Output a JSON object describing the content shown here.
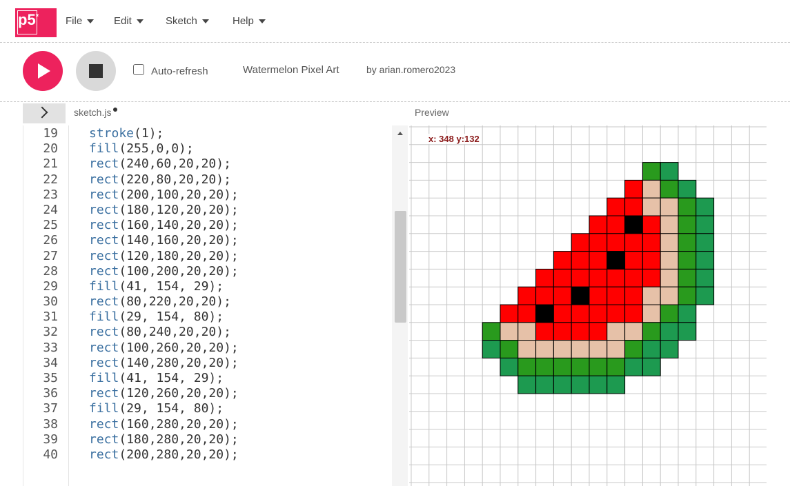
{
  "app": {
    "logo_text": "p5",
    "logo_mark": "*"
  },
  "menu": [
    {
      "label": "File"
    },
    {
      "label": "Edit"
    },
    {
      "label": "Sketch"
    },
    {
      "label": "Help"
    }
  ],
  "toolbar": {
    "auto_refresh_label": "Auto-refresh",
    "auto_refresh_checked": false,
    "sketch_title": "Watermelon Pixel Art",
    "author": "by arian.romero2023"
  },
  "editor": {
    "tab_name": "sketch.js",
    "lines": [
      {
        "n": "19",
        "fn": "stroke",
        "args": "(1);"
      },
      {
        "n": "20",
        "fn": "fill",
        "args": "(255,0,0);"
      },
      {
        "n": "21",
        "fn": "rect",
        "args": "(240,60,20,20);"
      },
      {
        "n": "22",
        "fn": "rect",
        "args": "(220,80,20,20);"
      },
      {
        "n": "23",
        "fn": "rect",
        "args": "(200,100,20,20);"
      },
      {
        "n": "24",
        "fn": "rect",
        "args": "(180,120,20,20);"
      },
      {
        "n": "25",
        "fn": "rect",
        "args": "(160,140,20,20);"
      },
      {
        "n": "26",
        "fn": "rect",
        "args": "(140,160,20,20);"
      },
      {
        "n": "27",
        "fn": "rect",
        "args": "(120,180,20,20);"
      },
      {
        "n": "28",
        "fn": "rect",
        "args": "(100,200,20,20);"
      },
      {
        "n": "29",
        "fn": "fill",
        "args": "(41, 154, 29);"
      },
      {
        "n": "30",
        "fn": "rect",
        "args": "(80,220,20,20);"
      },
      {
        "n": "31",
        "fn": "fill",
        "args": "(29, 154, 80);"
      },
      {
        "n": "32",
        "fn": "rect",
        "args": "(80,240,20,20);"
      },
      {
        "n": "33",
        "fn": "rect",
        "args": "(100,260,20,20);"
      },
      {
        "n": "34",
        "fn": "rect",
        "args": "(140,280,20,20);"
      },
      {
        "n": "35",
        "fn": "fill",
        "args": "(41, 154, 29);"
      },
      {
        "n": "36",
        "fn": "rect",
        "args": "(120,260,20,20);"
      },
      {
        "n": "37",
        "fn": "fill",
        "args": "(29, 154, 80);"
      },
      {
        "n": "38",
        "fn": "rect",
        "args": "(160,280,20,20);"
      },
      {
        "n": "39",
        "fn": "rect",
        "args": "(180,280,20,20);"
      },
      {
        "n": "40",
        "fn": "rect",
        "args": "(200,280,20,20);"
      }
    ]
  },
  "preview": {
    "title": "Preview",
    "coordinate_readout": "x: 348 y:132",
    "pixel_art": {
      "colors": {
        "R": "#ff0000",
        "B": "#000000",
        "P": "#e6c1a8",
        "G": "#299a1d",
        "D": "#1d9a50"
      },
      "rows": [
        {
          "row": 2,
          "cells": [
            {
              "col": 13,
              "c": "G"
            },
            {
              "col": 14,
              "c": "D"
            }
          ]
        },
        {
          "row": 3,
          "cells": [
            {
              "col": 12,
              "c": "R"
            },
            {
              "col": 13,
              "c": "P"
            },
            {
              "col": 14,
              "c": "G"
            },
            {
              "col": 15,
              "c": "D"
            }
          ]
        },
        {
          "row": 4,
          "cells": [
            {
              "col": 11,
              "c": "R"
            },
            {
              "col": 12,
              "c": "R"
            },
            {
              "col": 13,
              "c": "P"
            },
            {
              "col": 14,
              "c": "P"
            },
            {
              "col": 15,
              "c": "G"
            },
            {
              "col": 16,
              "c": "D"
            }
          ]
        },
        {
          "row": 5,
          "cells": [
            {
              "col": 10,
              "c": "R"
            },
            {
              "col": 11,
              "c": "R"
            },
            {
              "col": 12,
              "c": "B"
            },
            {
              "col": 13,
              "c": "R"
            },
            {
              "col": 14,
              "c": "P"
            },
            {
              "col": 15,
              "c": "G"
            },
            {
              "col": 16,
              "c": "D"
            }
          ]
        },
        {
          "row": 6,
          "cells": [
            {
              "col": 9,
              "c": "R"
            },
            {
              "col": 10,
              "c": "R"
            },
            {
              "col": 11,
              "c": "R"
            },
            {
              "col": 12,
              "c": "R"
            },
            {
              "col": 13,
              "c": "R"
            },
            {
              "col": 14,
              "c": "P"
            },
            {
              "col": 15,
              "c": "G"
            },
            {
              "col": 16,
              "c": "D"
            }
          ]
        },
        {
          "row": 7,
          "cells": [
            {
              "col": 8,
              "c": "R"
            },
            {
              "col": 9,
              "c": "R"
            },
            {
              "col": 10,
              "c": "R"
            },
            {
              "col": 11,
              "c": "B"
            },
            {
              "col": 12,
              "c": "R"
            },
            {
              "col": 13,
              "c": "R"
            },
            {
              "col": 14,
              "c": "P"
            },
            {
              "col": 15,
              "c": "G"
            },
            {
              "col": 16,
              "c": "D"
            }
          ]
        },
        {
          "row": 8,
          "cells": [
            {
              "col": 7,
              "c": "R"
            },
            {
              "col": 8,
              "c": "R"
            },
            {
              "col": 9,
              "c": "R"
            },
            {
              "col": 10,
              "c": "R"
            },
            {
              "col": 11,
              "c": "R"
            },
            {
              "col": 12,
              "c": "R"
            },
            {
              "col": 13,
              "c": "R"
            },
            {
              "col": 14,
              "c": "P"
            },
            {
              "col": 15,
              "c": "G"
            },
            {
              "col": 16,
              "c": "D"
            }
          ]
        },
        {
          "row": 9,
          "cells": [
            {
              "col": 6,
              "c": "R"
            },
            {
              "col": 7,
              "c": "R"
            },
            {
              "col": 8,
              "c": "R"
            },
            {
              "col": 9,
              "c": "B"
            },
            {
              "col": 10,
              "c": "R"
            },
            {
              "col": 11,
              "c": "R"
            },
            {
              "col": 12,
              "c": "R"
            },
            {
              "col": 13,
              "c": "P"
            },
            {
              "col": 14,
              "c": "P"
            },
            {
              "col": 15,
              "c": "G"
            },
            {
              "col": 16,
              "c": "D"
            }
          ]
        },
        {
          "row": 10,
          "cells": [
            {
              "col": 5,
              "c": "R"
            },
            {
              "col": 6,
              "c": "R"
            },
            {
              "col": 7,
              "c": "B"
            },
            {
              "col": 8,
              "c": "R"
            },
            {
              "col": 9,
              "c": "R"
            },
            {
              "col": 10,
              "c": "R"
            },
            {
              "col": 11,
              "c": "R"
            },
            {
              "col": 12,
              "c": "R"
            },
            {
              "col": 13,
              "c": "P"
            },
            {
              "col": 14,
              "c": "G"
            },
            {
              "col": 15,
              "c": "D"
            }
          ]
        },
        {
          "row": 11,
          "cells": [
            {
              "col": 4,
              "c": "G"
            },
            {
              "col": 5,
              "c": "P"
            },
            {
              "col": 6,
              "c": "P"
            },
            {
              "col": 7,
              "c": "R"
            },
            {
              "col": 8,
              "c": "R"
            },
            {
              "col": 9,
              "c": "R"
            },
            {
              "col": 10,
              "c": "R"
            },
            {
              "col": 11,
              "c": "P"
            },
            {
              "col": 12,
              "c": "P"
            },
            {
              "col": 13,
              "c": "G"
            },
            {
              "col": 14,
              "c": "D"
            },
            {
              "col": 15,
              "c": "D"
            }
          ]
        },
        {
          "row": 12,
          "cells": [
            {
              "col": 4,
              "c": "D"
            },
            {
              "col": 5,
              "c": "G"
            },
            {
              "col": 6,
              "c": "P"
            },
            {
              "col": 7,
              "c": "P"
            },
            {
              "col": 8,
              "c": "P"
            },
            {
              "col": 9,
              "c": "P"
            },
            {
              "col": 10,
              "c": "P"
            },
            {
              "col": 11,
              "c": "P"
            },
            {
              "col": 12,
              "c": "G"
            },
            {
              "col": 13,
              "c": "D"
            },
            {
              "col": 14,
              "c": "D"
            }
          ]
        },
        {
          "row": 13,
          "cells": [
            {
              "col": 5,
              "c": "D"
            },
            {
              "col": 6,
              "c": "G"
            },
            {
              "col": 7,
              "c": "G"
            },
            {
              "col": 8,
              "c": "G"
            },
            {
              "col": 9,
              "c": "G"
            },
            {
              "col": 10,
              "c": "G"
            },
            {
              "col": 11,
              "c": "G"
            },
            {
              "col": 12,
              "c": "D"
            },
            {
              "col": 13,
              "c": "D"
            }
          ]
        },
        {
          "row": 14,
          "cells": [
            {
              "col": 6,
              "c": "D"
            },
            {
              "col": 7,
              "c": "D"
            },
            {
              "col": 8,
              "c": "D"
            },
            {
              "col": 9,
              "c": "D"
            },
            {
              "col": 10,
              "c": "D"
            },
            {
              "col": 11,
              "c": "D"
            }
          ]
        }
      ]
    }
  }
}
